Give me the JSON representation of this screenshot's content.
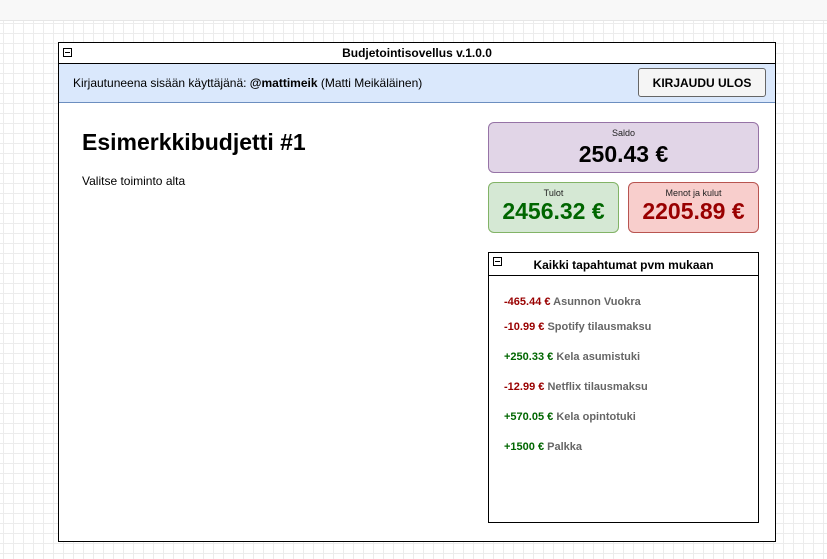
{
  "app": {
    "title": "Budjetointisovellus v.1.0.0"
  },
  "userbar": {
    "prefix": "Kirjautuneena sisään käyttäjänä: ",
    "username": "@mattimeik",
    "fullname": "(Matti Meikäläinen)",
    "logout_label": "KIRJAUDU ULOS"
  },
  "budget": {
    "title": "Esimerkkibudjetti #1",
    "instruction": "Valitse toiminto alta"
  },
  "summary": {
    "saldo": {
      "label": "Saldo",
      "value": "250.43 €"
    },
    "tulot": {
      "label": "Tulot",
      "value": "2456.32 €"
    },
    "menot": {
      "label": "Menot ja kulut",
      "value": "2205.89 €"
    }
  },
  "transactions": {
    "title": "Kaikki tapahtumat pvm mukaan",
    "items": [
      {
        "amount": "-465.44 €",
        "description": "Asunnon Vuokra",
        "type": "expense"
      },
      {
        "amount": "-10.99 €",
        "description": "Spotify tilausmaksu",
        "type": "expense"
      },
      {
        "amount": "+250.33 €",
        "description": "Kela asumistuki",
        "type": "income"
      },
      {
        "amount": "-12.99 €",
        "description": "Netflix tilausmaksu",
        "type": "expense"
      },
      {
        "amount": "+570.05 €",
        "description": "Kela opintotuki",
        "type": "income"
      },
      {
        "amount": "+1500 €",
        "description": "Palkka",
        "type": "income"
      }
    ]
  },
  "colors": {
    "income": "#006600",
    "expense": "#990000",
    "userbar_bg": "#dae8fc",
    "saldo_bg": "#e1d5e7",
    "tulot_bg": "#d5e8d4",
    "menot_bg": "#f8cecc"
  }
}
